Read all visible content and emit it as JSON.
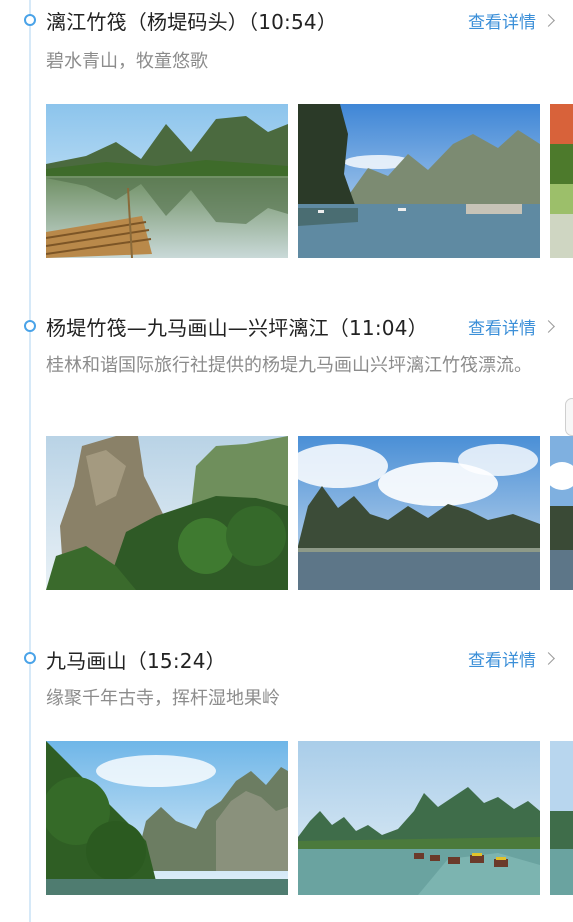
{
  "stops": [
    {
      "title": "漓江竹筏（杨堤码头）（10:54）",
      "detail_label": "查看详情",
      "description": "碧水青山，牧童悠歌",
      "photos": [
        {
          "scene": "river-bamboo-raft"
        },
        {
          "scene": "river-cliff-boats"
        },
        {
          "scene": "green-hill-partial"
        }
      ]
    },
    {
      "title": "杨堤竹筏—九马画山—兴坪漓江（11:04）",
      "detail_label": "查看详情",
      "description": "桂林和谐国际旅行社提供的杨堤九马画山兴坪漓江竹筏漂流。",
      "photos": [
        {
          "scene": "limestone-cliff-forest"
        },
        {
          "scene": "cloudy-karst-river"
        },
        {
          "scene": "sky-partial"
        }
      ]
    },
    {
      "title": "九马画山（15:24）",
      "detail_label": "查看详情",
      "description": "缘聚千年古寺，挥杆湿地果岭",
      "photos": [
        {
          "scene": "karst-valley-trees"
        },
        {
          "scene": "karst-river-rafts"
        },
        {
          "scene": "river-partial"
        }
      ]
    }
  ],
  "colors": {
    "accent": "#3b8fd8",
    "timeline": "#d6e9f8",
    "dot": "#4aa3e8",
    "title": "#222222",
    "description": "#8c8c8c"
  }
}
